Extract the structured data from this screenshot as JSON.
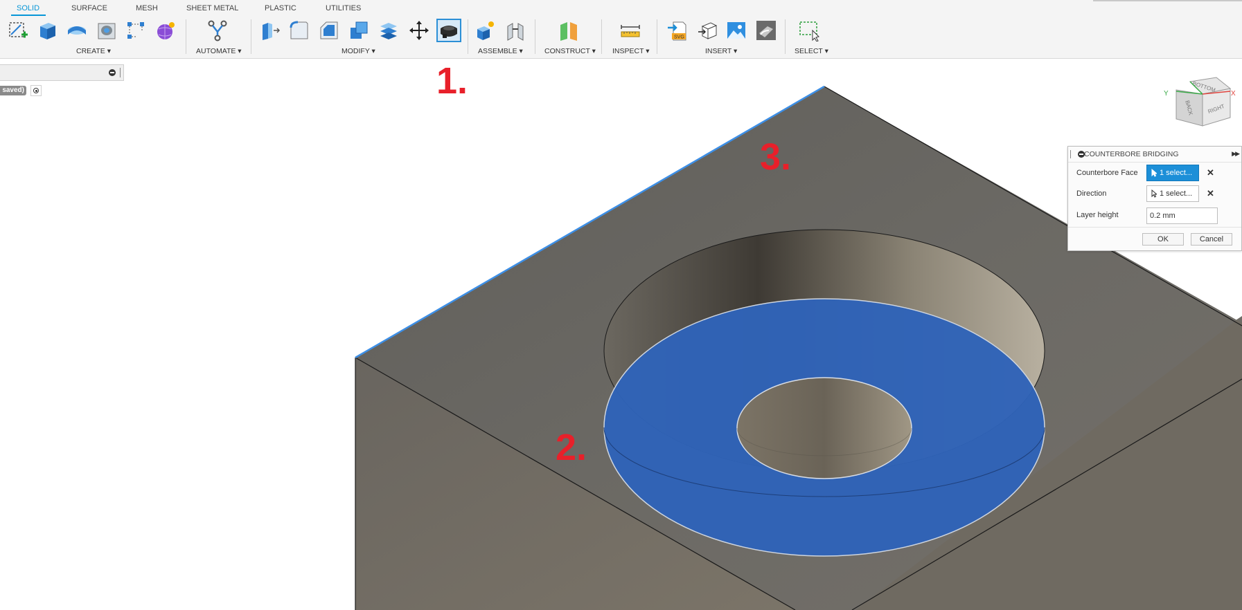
{
  "tabs": [
    {
      "label": "SOLID",
      "active": true
    },
    {
      "label": "SURFACE"
    },
    {
      "label": "MESH"
    },
    {
      "label": "SHEET METAL"
    },
    {
      "label": "PLASTIC"
    },
    {
      "label": "UTILITIES"
    }
  ],
  "groups": {
    "create": "CREATE ▾",
    "automate": "AUTOMATE ▾",
    "modify": "MODIFY ▾",
    "assemble": "ASSEMBLE ▾",
    "construct": "CONSTRUCT ▾",
    "inspect": "INSPECT ▾",
    "insert": "INSERT ▾",
    "select": "SELECT ▾"
  },
  "browser": {
    "document_status": "saved)"
  },
  "markers": [
    "1.",
    "2.",
    "3."
  ],
  "viewcube": {
    "faces": [
      "BOTTOM",
      "BACK",
      "RIGHT"
    ],
    "axes": [
      "Y",
      "X"
    ]
  },
  "panel": {
    "title": "COUNTERBORE BRIDGING",
    "rows": [
      {
        "label": "Counterbore Face",
        "value": "1 select...",
        "active": true
      },
      {
        "label": "Direction",
        "value": "1 select...",
        "active": false
      },
      {
        "label": "Layer height",
        "value": "0.2 mm"
      }
    ],
    "ok": "OK",
    "cancel": "Cancel"
  },
  "colors": {
    "accent": "#0696d7",
    "highlight_face": "#2f63b8",
    "model": "#6e6c68",
    "marker": "#e8202a"
  }
}
